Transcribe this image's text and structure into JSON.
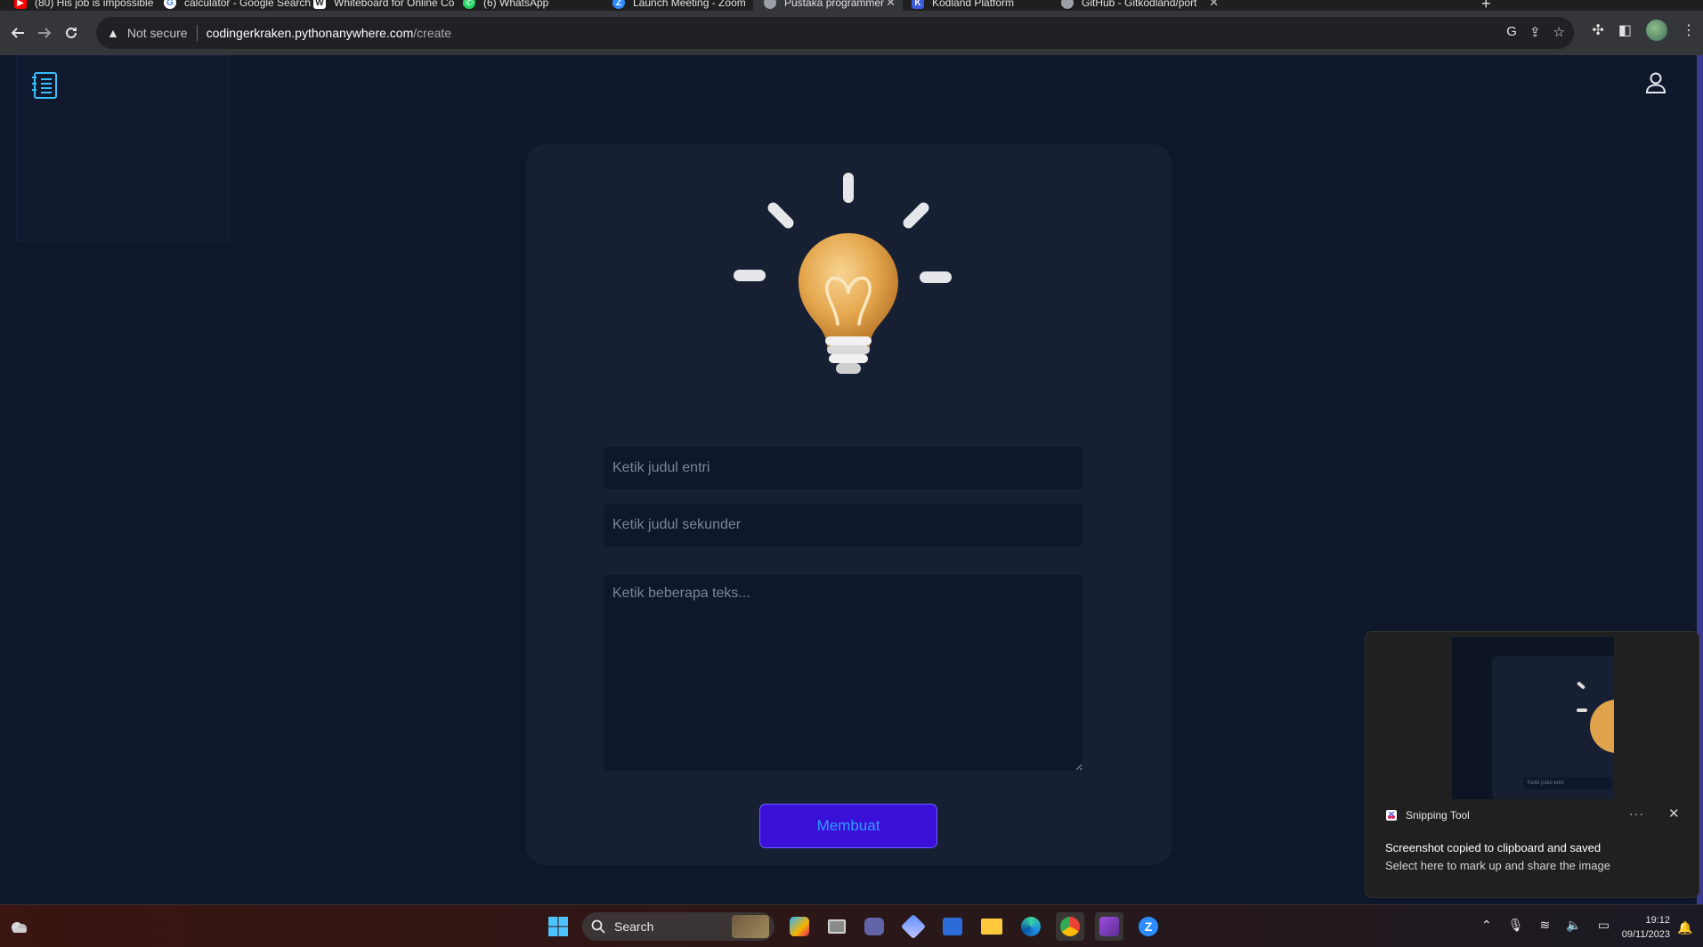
{
  "browser": {
    "tabs": [
      {
        "title": "(80) His job is impossible",
        "favicon": "youtube-icon",
        "color": "#ff0000"
      },
      {
        "title": "calculator - Google Search",
        "favicon": "google-icon",
        "color": "#ffffff"
      },
      {
        "title": "Whiteboard for Online Co",
        "favicon": "whiteboard-icon",
        "color": "#ffffff"
      },
      {
        "title": "(6) WhatsApp",
        "favicon": "whatsapp-icon",
        "color": "#25d366"
      },
      {
        "title": "Launch Meeting - Zoom",
        "favicon": "zoom-icon",
        "color": "#2d8cff"
      },
      {
        "title": "Pustaka programmer",
        "favicon": "globe-icon",
        "color": "#9aa0a6"
      },
      {
        "title": "Kodland Platform",
        "favicon": "kodland-icon",
        "color": "#3b5bdb"
      },
      {
        "title": "GitHub - Gitkodland/port",
        "favicon": "github-icon",
        "color": "#9aa0a6"
      }
    ],
    "address": {
      "security": "Not secure",
      "host": "codingerkraken.pythonanywhere.com",
      "path": "/create"
    }
  },
  "page": {
    "form": {
      "title_placeholder": "Ketik judul entri",
      "subtitle_placeholder": "Ketik judul sekunder",
      "body_placeholder": "Ketik beberapa teks...",
      "submit_label": "Membuat"
    },
    "colors": {
      "background": "#0f172a",
      "card": "#172033",
      "button": "#3a10d9",
      "button_text": "#2f9cff"
    }
  },
  "notification": {
    "app": "Snipping Tool",
    "message": "Screenshot copied to clipboard and saved",
    "subtext": "Select here to mark up and share the image",
    "thumb_field_text": "Ketik judul entri"
  },
  "taskbar": {
    "search_label": "Search",
    "time": "19:12",
    "date": "09/11/2023"
  }
}
